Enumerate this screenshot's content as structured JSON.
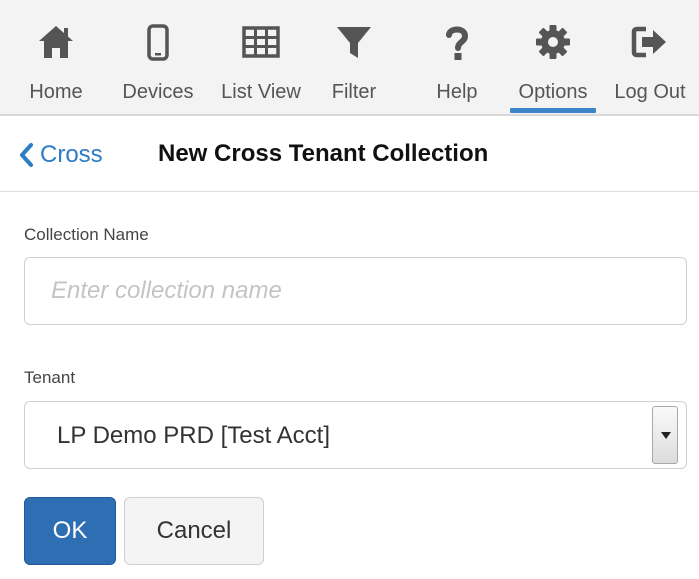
{
  "toolbar": {
    "items": [
      {
        "label": "Home",
        "icon": "home-icon"
      },
      {
        "label": "Devices",
        "icon": "mobile-icon"
      },
      {
        "label": "List View",
        "icon": "grid-icon"
      },
      {
        "label": "Filter",
        "icon": "filter-icon"
      },
      {
        "label": "Help",
        "icon": "question-icon"
      },
      {
        "label": "Options",
        "icon": "gear-icon",
        "active": true
      },
      {
        "label": "Log Out",
        "icon": "logout-icon"
      }
    ],
    "icon_color": "#555555",
    "active_underline_color": "#3a86c8"
  },
  "header": {
    "back_label": "Cross",
    "title": "New Cross Tenant Collection"
  },
  "form": {
    "collection_name_label": "Collection Name",
    "collection_name_placeholder": "Enter collection name",
    "collection_name_value": "",
    "tenant_label": "Tenant",
    "tenant_selected": "LP Demo PRD [Test Acct]",
    "ok_label": "OK",
    "cancel_label": "Cancel"
  },
  "colors": {
    "link": "#2e7cc4",
    "primary_button": "#2e6fb3"
  }
}
